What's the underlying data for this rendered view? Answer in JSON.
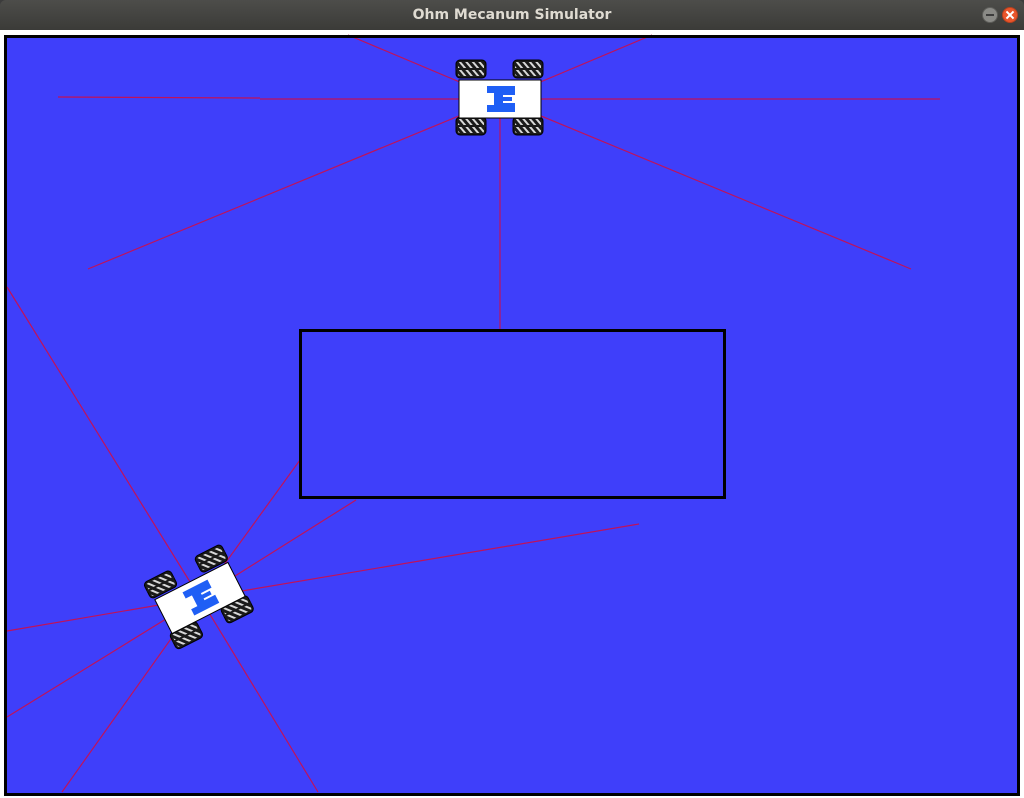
{
  "window": {
    "title": "Ohm Mecanum Simulator"
  },
  "scene": {
    "floor_color": "#3f3ffa",
    "wall_color": "#000000",
    "laser_color": "#c0125a",
    "robot_body_color": "#ffffff",
    "robot_logo_color": "#1f5ff5",
    "wheel_color": "#1a1a1a"
  },
  "robots": [
    {
      "id": "robot-1",
      "heading_deg": 0
    },
    {
      "id": "robot-2",
      "heading_deg": -27
    }
  ]
}
